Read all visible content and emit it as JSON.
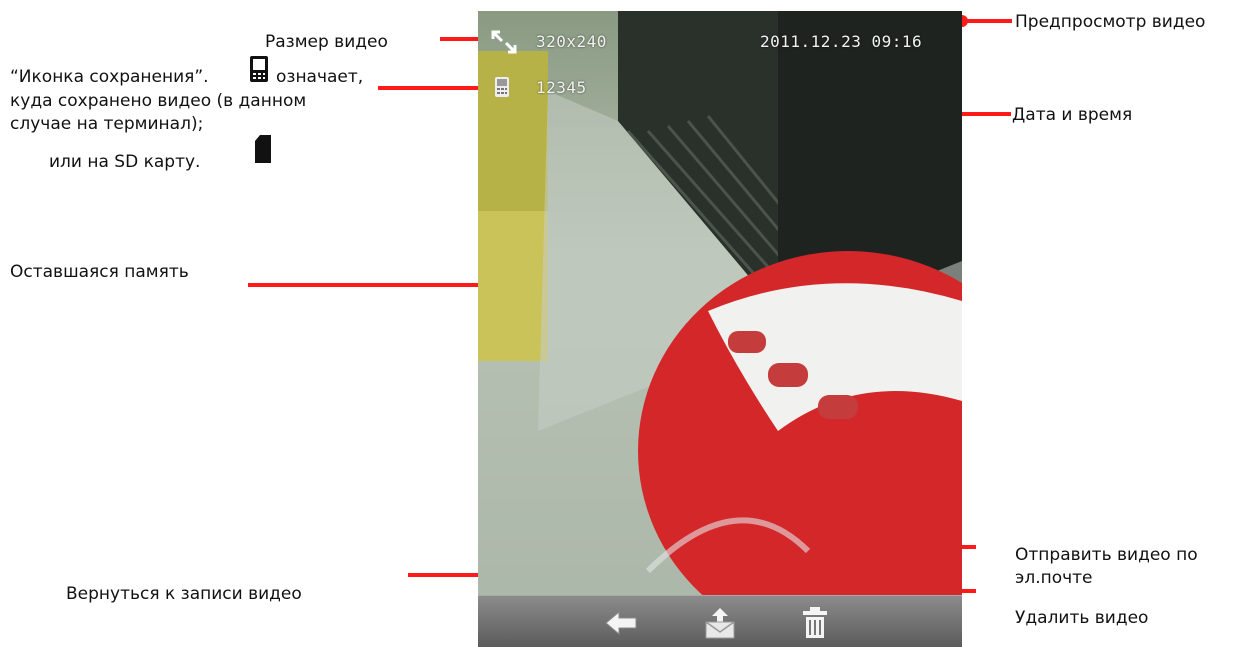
{
  "annotations": {
    "video_size": "Размер видео",
    "save_icon_desc_1": "“Иконка сохранения”.",
    "save_icon_desc_2": "означает,",
    "save_icon_desc_3": "куда сохранено видео (в данном",
    "save_icon_desc_4": "случае на терминал);",
    "save_icon_desc_5": "или на SD карту.",
    "remaining_memory": "Оставшаяся память",
    "back_to_recording": "Вернуться к записи видео",
    "video_preview": "Предпросмотр видео",
    "date_time": "Дата и время",
    "send_email_1": "Отправить видео по",
    "send_email_2": "эл.почте",
    "delete_video": "Удалить видео"
  },
  "hud": {
    "resolution": "320x240",
    "datetime": "2011.12.23 09:16",
    "remaining": "12345"
  },
  "icons": {
    "resize": "resize-arrows-icon",
    "storage": "phone-storage-icon",
    "sd": "sd-card-icon",
    "back": "back-arrow-icon",
    "email": "send-email-icon",
    "delete": "trash-icon"
  },
  "colors": {
    "callout": "#ff1a1a",
    "toolbar": "#6b6b6b"
  }
}
